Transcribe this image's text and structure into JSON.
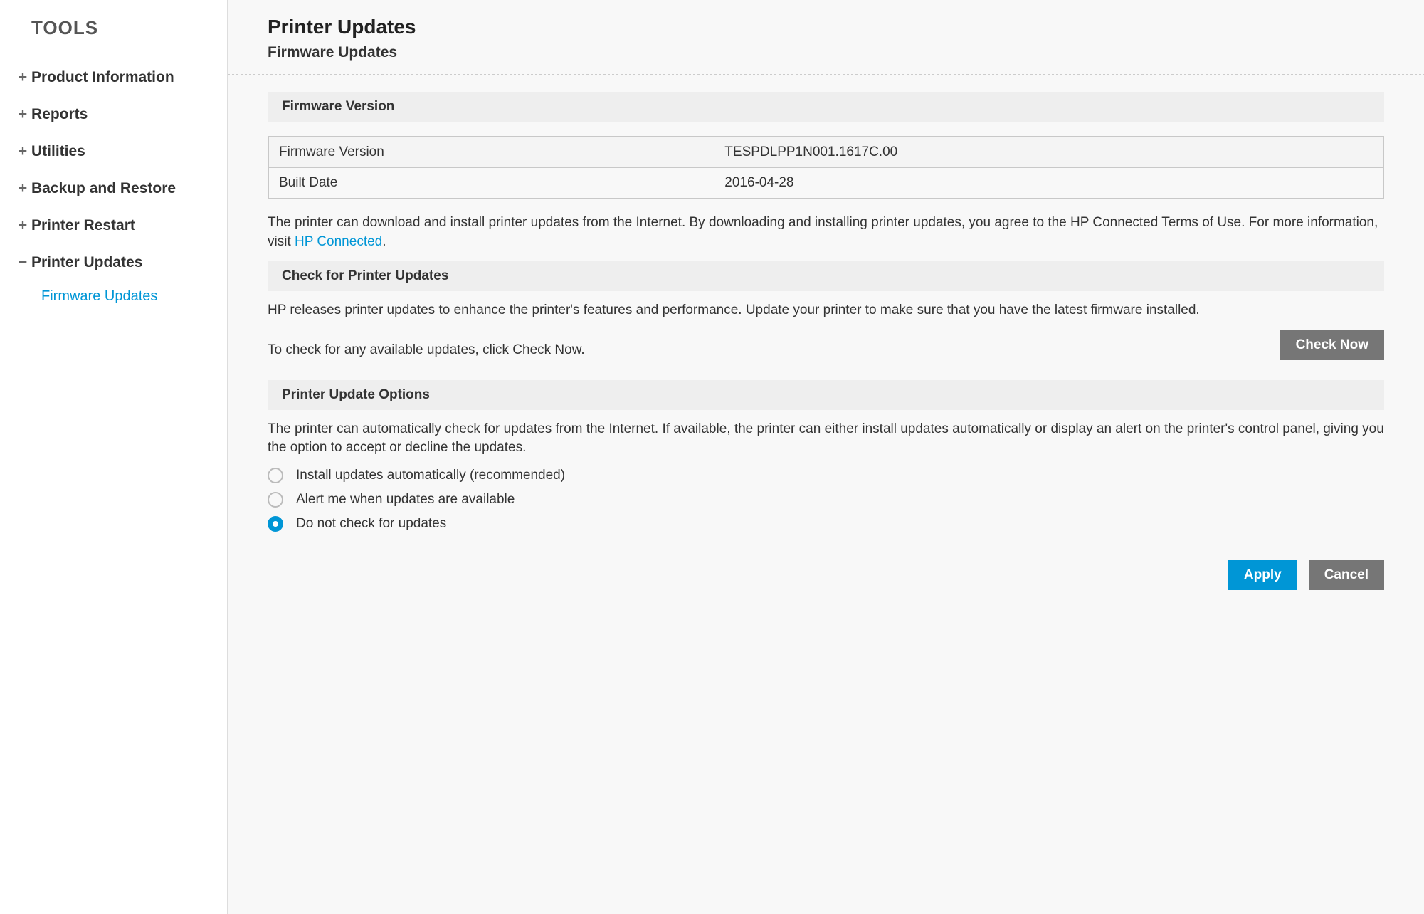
{
  "sidebar": {
    "title": "TOOLS",
    "items": [
      {
        "label": "Product Information",
        "expand": "+"
      },
      {
        "label": "Reports",
        "expand": "+"
      },
      {
        "label": "Utilities",
        "expand": "+"
      },
      {
        "label": "Backup and Restore",
        "expand": "+"
      },
      {
        "label": "Printer Restart",
        "expand": "+"
      },
      {
        "label": "Printer Updates",
        "expand": "−"
      }
    ],
    "sub_item": "Firmware Updates"
  },
  "header": {
    "title": "Printer Updates",
    "subtitle": "Firmware Updates"
  },
  "firmware_section": {
    "heading": "Firmware Version",
    "row1_label": "Firmware Version",
    "row1_value": "TESPDLPP1N001.1617C.00",
    "row2_label": "Built Date",
    "row2_value": "2016-04-28",
    "description_a": "The printer can download and install printer updates from the Internet. By downloading and installing printer updates, you agree to the HP Connected Terms of Use. For more information, visit ",
    "link_text": "HP Connected",
    "description_b": "."
  },
  "check_section": {
    "heading": "Check for Printer Updates",
    "text1": "HP releases printer updates to enhance the printer's features and performance. Update your printer to make sure that you have the latest firmware installed.",
    "text2": "To check for any available updates, click Check Now.",
    "button": "Check Now"
  },
  "options_section": {
    "heading": "Printer Update Options",
    "text": "The printer can automatically check for updates from the Internet. If available, the printer can either install updates automatically or display an alert on the printer's control panel, giving you the option to accept or decline the updates.",
    "radio1": "Install updates automatically (recommended)",
    "radio2": "Alert me when updates are available",
    "radio3": "Do not check for updates"
  },
  "buttons": {
    "apply": "Apply",
    "cancel": "Cancel"
  }
}
